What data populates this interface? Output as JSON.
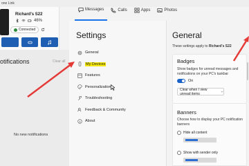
{
  "app": {
    "title": "one Link"
  },
  "tabs": [
    {
      "label": "Messages",
      "icon": "chat-icon"
    },
    {
      "label": "Calls",
      "icon": "phone-icon"
    },
    {
      "label": "Apps",
      "icon": "apps-grid-icon"
    },
    {
      "label": "Photos",
      "icon": "image-icon"
    }
  ],
  "device": {
    "name": "Richard's S22",
    "battery": "46%",
    "connection": "Connected"
  },
  "notifications": {
    "title": "otifications",
    "clear_all": "Clear all",
    "empty": "No new notifications"
  },
  "settings": {
    "title": "Settings",
    "items": [
      {
        "label": "General",
        "icon": "gear-icon"
      },
      {
        "label": "My Devices",
        "icon": "phone-device-icon",
        "highlight": "#f5e60a"
      },
      {
        "label": "Features",
        "icon": "features-icon"
      },
      {
        "label": "Personalization",
        "icon": "palette-icon"
      },
      {
        "label": "Troubleshooting",
        "icon": "wrench-icon"
      },
      {
        "label": "Feedback & Community",
        "icon": "feedback-icon"
      },
      {
        "label": "About",
        "icon": "info-icon"
      }
    ]
  },
  "general": {
    "title": "General",
    "applies_prefix": "These settings apply to ",
    "applies_device": "Richard's S22",
    "badges": {
      "title": "Badges",
      "description": "Show badges for unread messages and notifications on your PC's taskbar",
      "toggle_label": "On",
      "dropdown_value": "Clear when I view unread items"
    },
    "banners": {
      "title": "Banners",
      "description": "Choose how to display your PC notification banners",
      "options": [
        "Hide all content",
        "Show with sender only"
      ]
    }
  },
  "colors": {
    "accent": "#1a62c7",
    "arrow": "#e53935",
    "connected": "#2e8b3a"
  }
}
